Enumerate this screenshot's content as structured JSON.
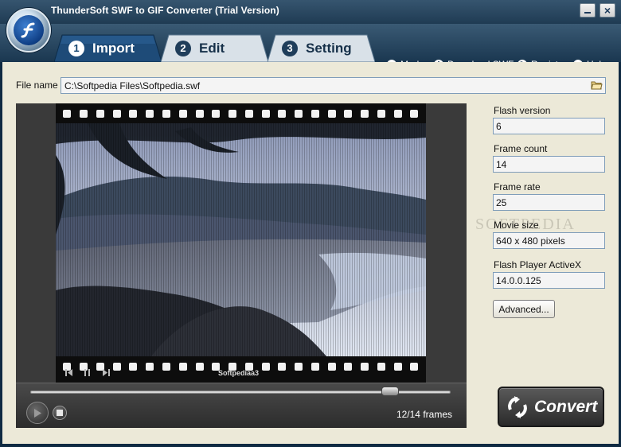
{
  "window": {
    "title": "ThunderSoft SWF to GIF Converter (Trial Version)",
    "minimize_label": "_",
    "close_label": "×"
  },
  "tabs": [
    {
      "number": "1",
      "label": "Import",
      "active": true
    },
    {
      "number": "2",
      "label": "Edit",
      "active": false
    },
    {
      "number": "3",
      "label": "Setting",
      "active": false
    }
  ],
  "topmenu": {
    "mode": {
      "icon": "M",
      "label": "Mode"
    },
    "download": {
      "label": "Download SWF"
    },
    "register": {
      "label": "Register"
    },
    "help": {
      "icon": "?",
      "label": "Help"
    }
  },
  "file": {
    "label": "File name",
    "value": "C:\\Softpedia Files\\Softpedia.swf"
  },
  "preview": {
    "caption": "Softpediaa3"
  },
  "player": {
    "progress": 0.857,
    "frame_counter": "12/14 frames"
  },
  "info": {
    "flash_version": {
      "label": "Flash version",
      "value": "6"
    },
    "frame_count": {
      "label": "Frame count",
      "value": "14"
    },
    "frame_rate": {
      "label": "Frame rate",
      "value": "25"
    },
    "movie_size": {
      "label": "Movie size",
      "value": "640 x 480 pixels"
    },
    "activex": {
      "label": "Flash Player ActiveX",
      "value": "14.0.0.125"
    }
  },
  "watermark": "SOFTPEDIA",
  "advanced_label": "Advanced...",
  "convert_label": "Convert",
  "colors": {
    "accent": "#15446f",
    "panel": "#ece9d8",
    "titlebar": "#1f3b53"
  }
}
